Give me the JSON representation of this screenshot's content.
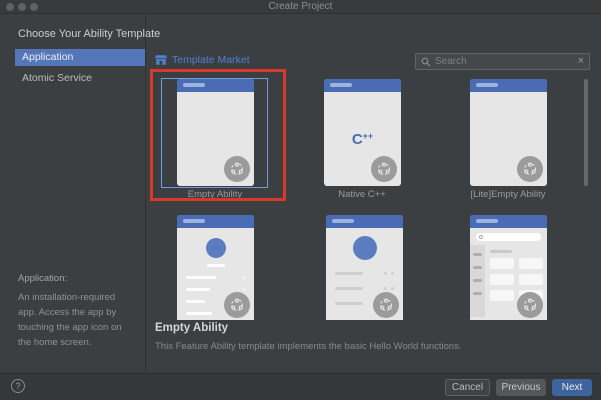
{
  "window": {
    "title": "Create Project"
  },
  "sidebar": {
    "heading": "Choose Your Ability Template",
    "items": [
      {
        "label": "Application",
        "selected": true
      },
      {
        "label": "Atomic Service",
        "selected": false
      }
    ],
    "info_title": "Application:",
    "info_text": "An installation-required app. Access the app by touching the app icon on the home screen."
  },
  "market": {
    "label": "Template Market"
  },
  "search": {
    "placeholder": "Search",
    "clear_glyph": "×"
  },
  "templates": {
    "cards_row1": [
      {
        "name": "Empty Ability",
        "selected": true,
        "annotated": true
      },
      {
        "name": "Native C++",
        "logo_c": "C",
        "logo_plus": "++"
      },
      {
        "name": "[Lite]Empty Ability"
      }
    ]
  },
  "detail": {
    "title": "Empty Ability",
    "description": "This Feature Ability template implements the basic Hello World functions."
  },
  "footer": {
    "help_label": "?",
    "cancel_label": "Cancel",
    "previous_label": "Previous",
    "next_label": "Next"
  },
  "colors": {
    "accent_blue": "#4a6cb4",
    "link_blue": "#4e80d0",
    "selection_blue": "#5577b9",
    "selection_border": "#6f9cd8",
    "annotation_red": "#d7392d",
    "next_button_blue": "#3d649c",
    "background": "#3c3f41"
  }
}
